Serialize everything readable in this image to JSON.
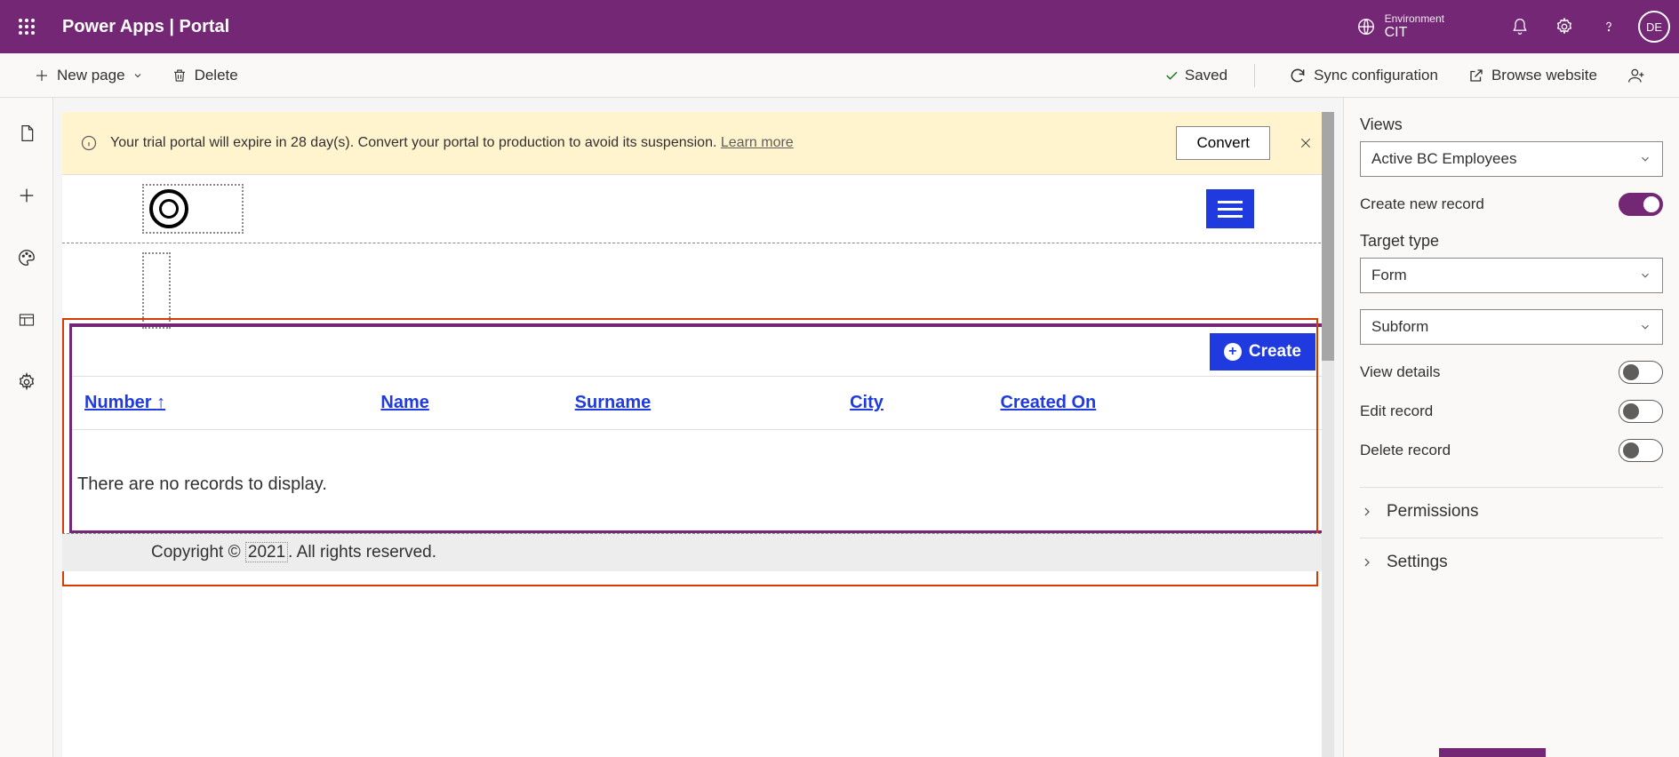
{
  "header": {
    "brand": "Power Apps  |  Portal",
    "environment_label": "Environment",
    "environment_value": "CIT",
    "avatar_initials": "DE"
  },
  "commandbar": {
    "new_page": "New page",
    "delete": "Delete",
    "saved": "Saved",
    "sync": "Sync configuration",
    "browse": "Browse website"
  },
  "trial": {
    "message_prefix": "Your trial portal will expire in 28 day(s). Convert your portal to production to avoid its suspension. ",
    "learn_more": "Learn more",
    "convert": "Convert"
  },
  "list": {
    "create_button": "Create",
    "columns": [
      "Number",
      "Name",
      "Surname",
      "City",
      "Created On"
    ],
    "sorted_col_index": 0,
    "empty": "There are no records to display."
  },
  "footer": {
    "prefix": "Copyright © ",
    "year": "2021",
    "suffix": ". All rights reserved."
  },
  "panel": {
    "views_label": "Views",
    "views_value": "Active BC Employees",
    "create_new_record": "Create new record",
    "target_type_label": "Target type",
    "target_type_value": "Form",
    "subform_value": "Subform",
    "view_details": "View details",
    "edit_record": "Edit record",
    "delete_record": "Delete record",
    "permissions": "Permissions",
    "settings": "Settings",
    "toggles": {
      "create_new_record": true,
      "view_details": false,
      "edit_record": false,
      "delete_record": false
    }
  }
}
